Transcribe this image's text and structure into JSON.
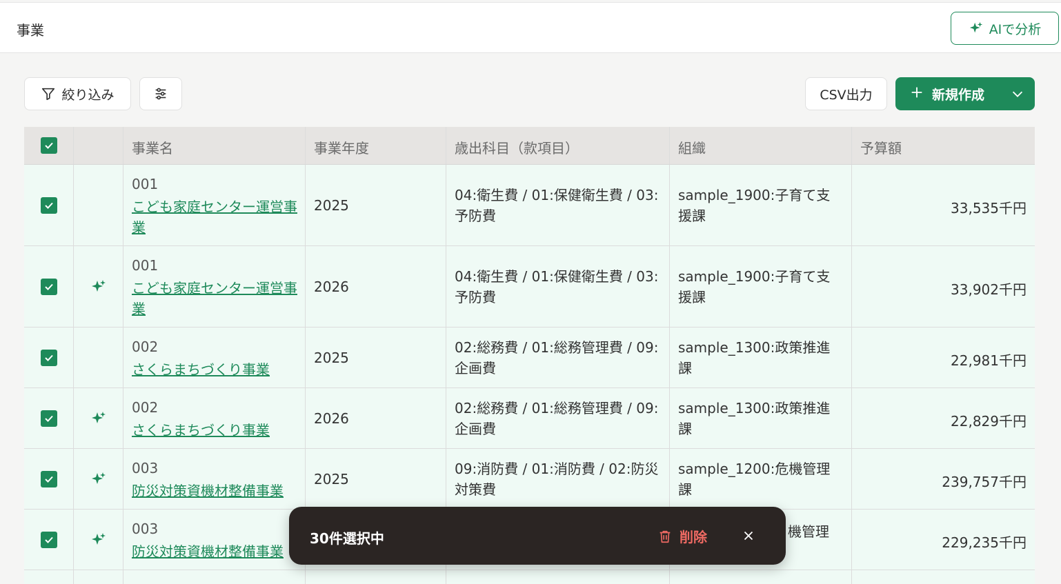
{
  "header": {
    "title": "事業",
    "ai_button": "AIで分析"
  },
  "toolbar": {
    "filter_label": "絞り込み",
    "csv_label": "CSV出力",
    "new_label": "新規作成"
  },
  "table": {
    "columns": [
      "事業名",
      "事業年度",
      "歳出科目（款項目）",
      "組織",
      "予算額"
    ],
    "rows": [
      {
        "checked": true,
        "ai": false,
        "code": "001",
        "name": "こども家庭センター運営事業",
        "year": "2025",
        "account": "04:衛生費 / 01:保健衛生費 / 03:予防費",
        "org": "sample_1900:子育て支援課",
        "amount": "33,535千円"
      },
      {
        "checked": true,
        "ai": true,
        "code": "001",
        "name": "こども家庭センター運営事業",
        "year": "2026",
        "account": "04:衛生費 / 01:保健衛生費 / 03:予防費",
        "org": "sample_1900:子育て支援課",
        "amount": "33,902千円"
      },
      {
        "checked": true,
        "ai": false,
        "code": "002",
        "name": "さくらまちづくり事業",
        "year": "2025",
        "account": "02:総務費 / 01:総務管理費 / 09:企画費",
        "org": "sample_1300:政策推進課",
        "amount": "22,981千円"
      },
      {
        "checked": true,
        "ai": true,
        "code": "002",
        "name": "さくらまちづくり事業",
        "year": "2026",
        "account": "02:総務費 / 01:総務管理費 / 09:企画費",
        "org": "sample_1300:政策推進課",
        "amount": "22,829千円"
      },
      {
        "checked": true,
        "ai": true,
        "code": "003",
        "name": "防災対策資機材整備事業",
        "year": "2025",
        "account": "09:消防費 / 01:消防費 / 02:防災対策費",
        "org": "sample_1200:危機管理課",
        "amount": "239,757千円"
      },
      {
        "checked": true,
        "ai": true,
        "code": "003",
        "name": "防災対策資機材整備事業",
        "org_visible": "機管理",
        "amount": "229,235千円"
      }
    ]
  },
  "toast": {
    "selected_text": "30件選択中",
    "delete_label": "削除"
  },
  "colors": {
    "accent": "#1e8a5a",
    "row_bg": "#effaf5",
    "danger": "#ef6a63",
    "toast_bg": "#2b2523"
  }
}
